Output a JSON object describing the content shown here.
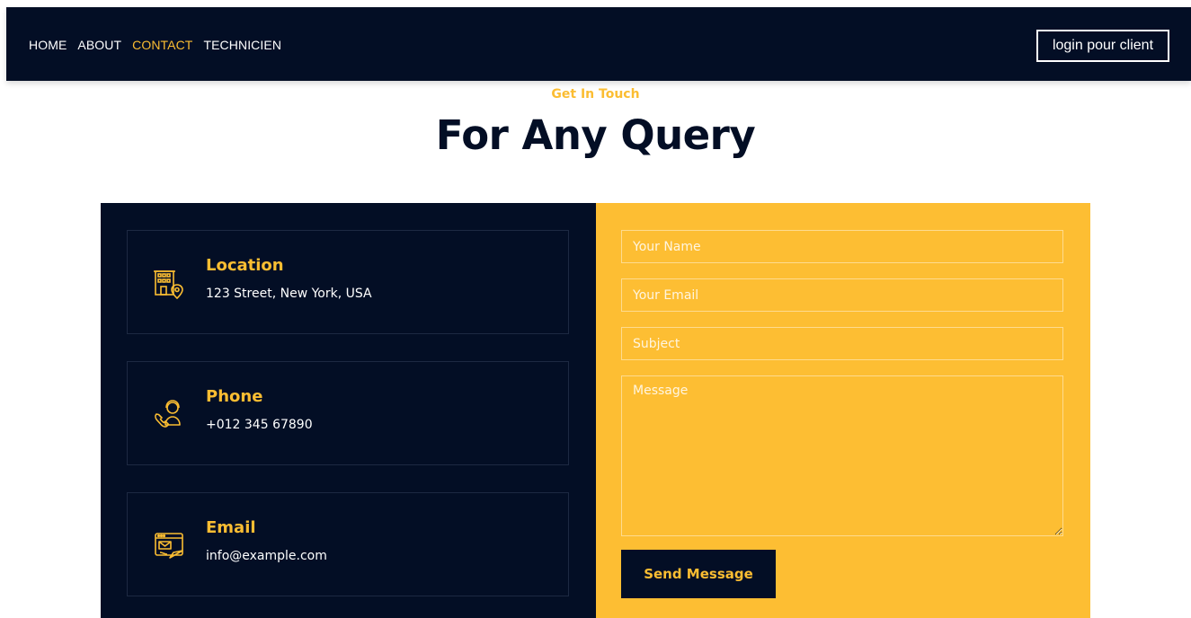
{
  "nav": {
    "links": [
      {
        "label": "HOME",
        "active": false
      },
      {
        "label": "ABOUT",
        "active": false
      },
      {
        "label": "CONTACT",
        "active": true
      },
      {
        "label": "TECHNICIEN",
        "active": false
      }
    ],
    "login_label": "login pour client"
  },
  "section": {
    "eyebrow": "Get In Touch",
    "title": "For Any Query"
  },
  "contact_info": [
    {
      "title": "Location",
      "value": "123 Street, New York, USA",
      "icon": "building-location-icon"
    },
    {
      "title": "Phone",
      "value": "+012 345 67890",
      "icon": "phone-support-icon"
    },
    {
      "title": "Email",
      "value": "info@example.com",
      "icon": "email-browser-icon"
    }
  ],
  "form": {
    "name_placeholder": "Your Name",
    "email_placeholder": "Your Email",
    "subject_placeholder": "Subject",
    "message_placeholder": "Message",
    "submit_label": "Send Message"
  },
  "colors": {
    "navy": "#030e25",
    "accent": "#fbbd32",
    "panel_yellow": "#fdbe33"
  }
}
